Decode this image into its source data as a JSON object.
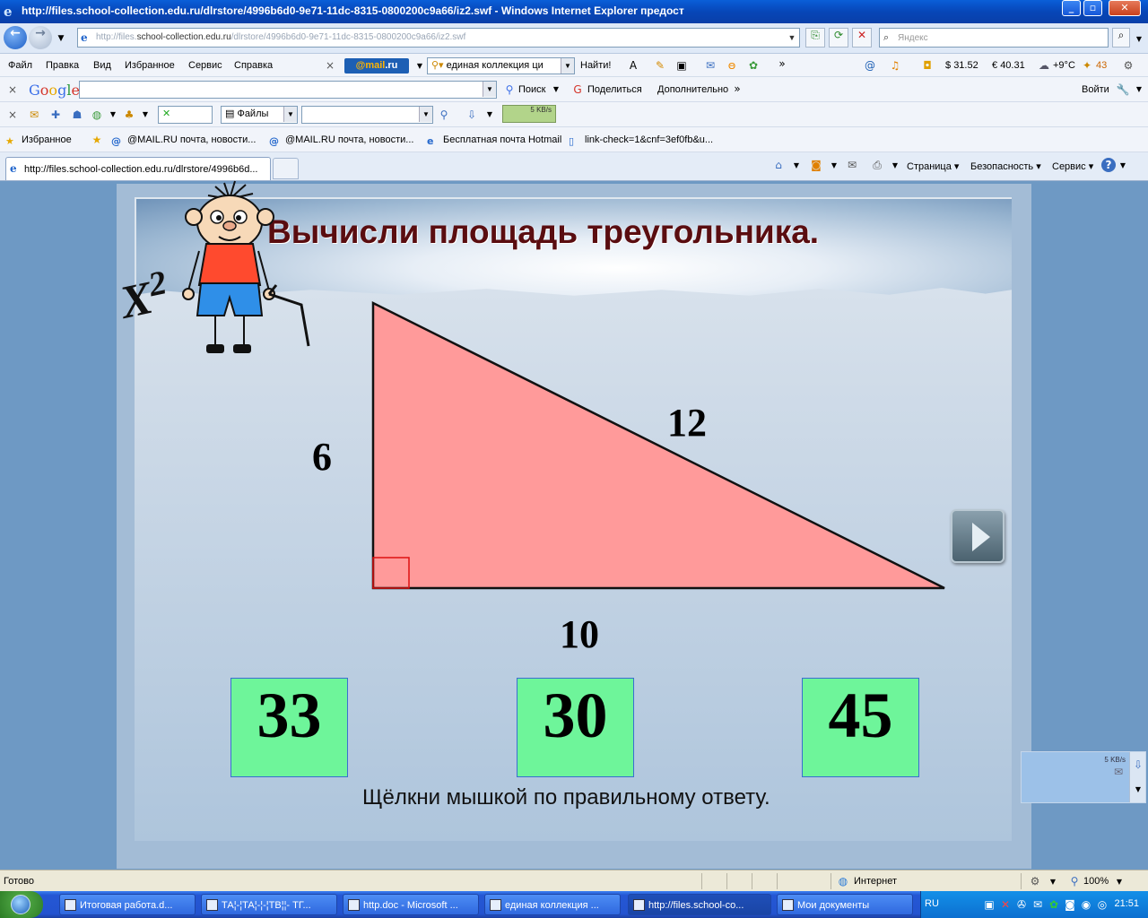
{
  "window": {
    "title": "http://files.school-collection.edu.ru/dlrstore/4996b6d0-9e71-11dc-8315-0800200c9a66/iz2.swf - Windows Internet Explorer предост"
  },
  "address_bar": {
    "url_prefix": "http://files.",
    "url_host": "school-collection.edu.ru",
    "url_path": "/dlrstore/4996b6d0-9e71-11dc-8315-0800200c9a66/iz2.swf",
    "search_placeholder": "Яндекс"
  },
  "menu": {
    "items": [
      "Файл",
      "Правка",
      "Вид",
      "Избранное",
      "Сервис",
      "Справка"
    ],
    "mail_logo": "@mail",
    "mail_logo_ru": ".ru",
    "search_query": "единая коллекция ци",
    "find_label": "Найти!",
    "dollar": "31.52",
    "euro": "40.31",
    "weather": "+9°C",
    "traffic": "43"
  },
  "google_bar": {
    "logo": [
      "G",
      "o",
      "o",
      "g",
      "l",
      "e"
    ],
    "search_label": "Поиск",
    "share_label": "Поделиться",
    "more_label": "Дополнительно",
    "login_label": "Войти"
  },
  "tool_bar": {
    "files_label": "Файлы",
    "speed_label": "5 KB/s"
  },
  "favorites": {
    "label": "Избранное",
    "items": [
      "@MAIL.RU почта, новости...",
      "@MAIL.RU почта, новости...",
      "Бесплатная почта Hotmail",
      "link-check=1&cnf=3ef0fb&u..."
    ]
  },
  "tabs": {
    "active": "http://files.school-collection.edu.ru/dlrstore/4996b6d...",
    "commands": [
      "Страница",
      "Безопасность",
      "Сервис"
    ]
  },
  "slide": {
    "title": "Вычисли площадь треугольника.",
    "x2_base": "X",
    "x2_exp": "2",
    "side_left": "6",
    "side_hyp": "12",
    "side_bottom": "10",
    "answers": [
      "33",
      "30",
      "45"
    ],
    "hint": "Щёлкни мышкой по правильному ответу.",
    "float_speed": "5 KB/s"
  },
  "status": {
    "left": "Готово",
    "zone": "Интернет",
    "zoom": "100%"
  },
  "taskbar": {
    "tasks": [
      "Итоговая работа.d...",
      "ТА¦-¦ТА¦-¦-¦ТВ¦¦- ТГ...",
      "http.doc - Microsoft ...",
      "единая коллекция ...",
      "http://files.school-co...",
      "Мои документы"
    ],
    "lang": "RU",
    "clock": "21:51"
  },
  "colors": {
    "triangle_fill": "#ff9a9a",
    "answer_fill": "#6ef59a",
    "title_color": "#5a0d10",
    "content_bg": "#6e99c4"
  }
}
